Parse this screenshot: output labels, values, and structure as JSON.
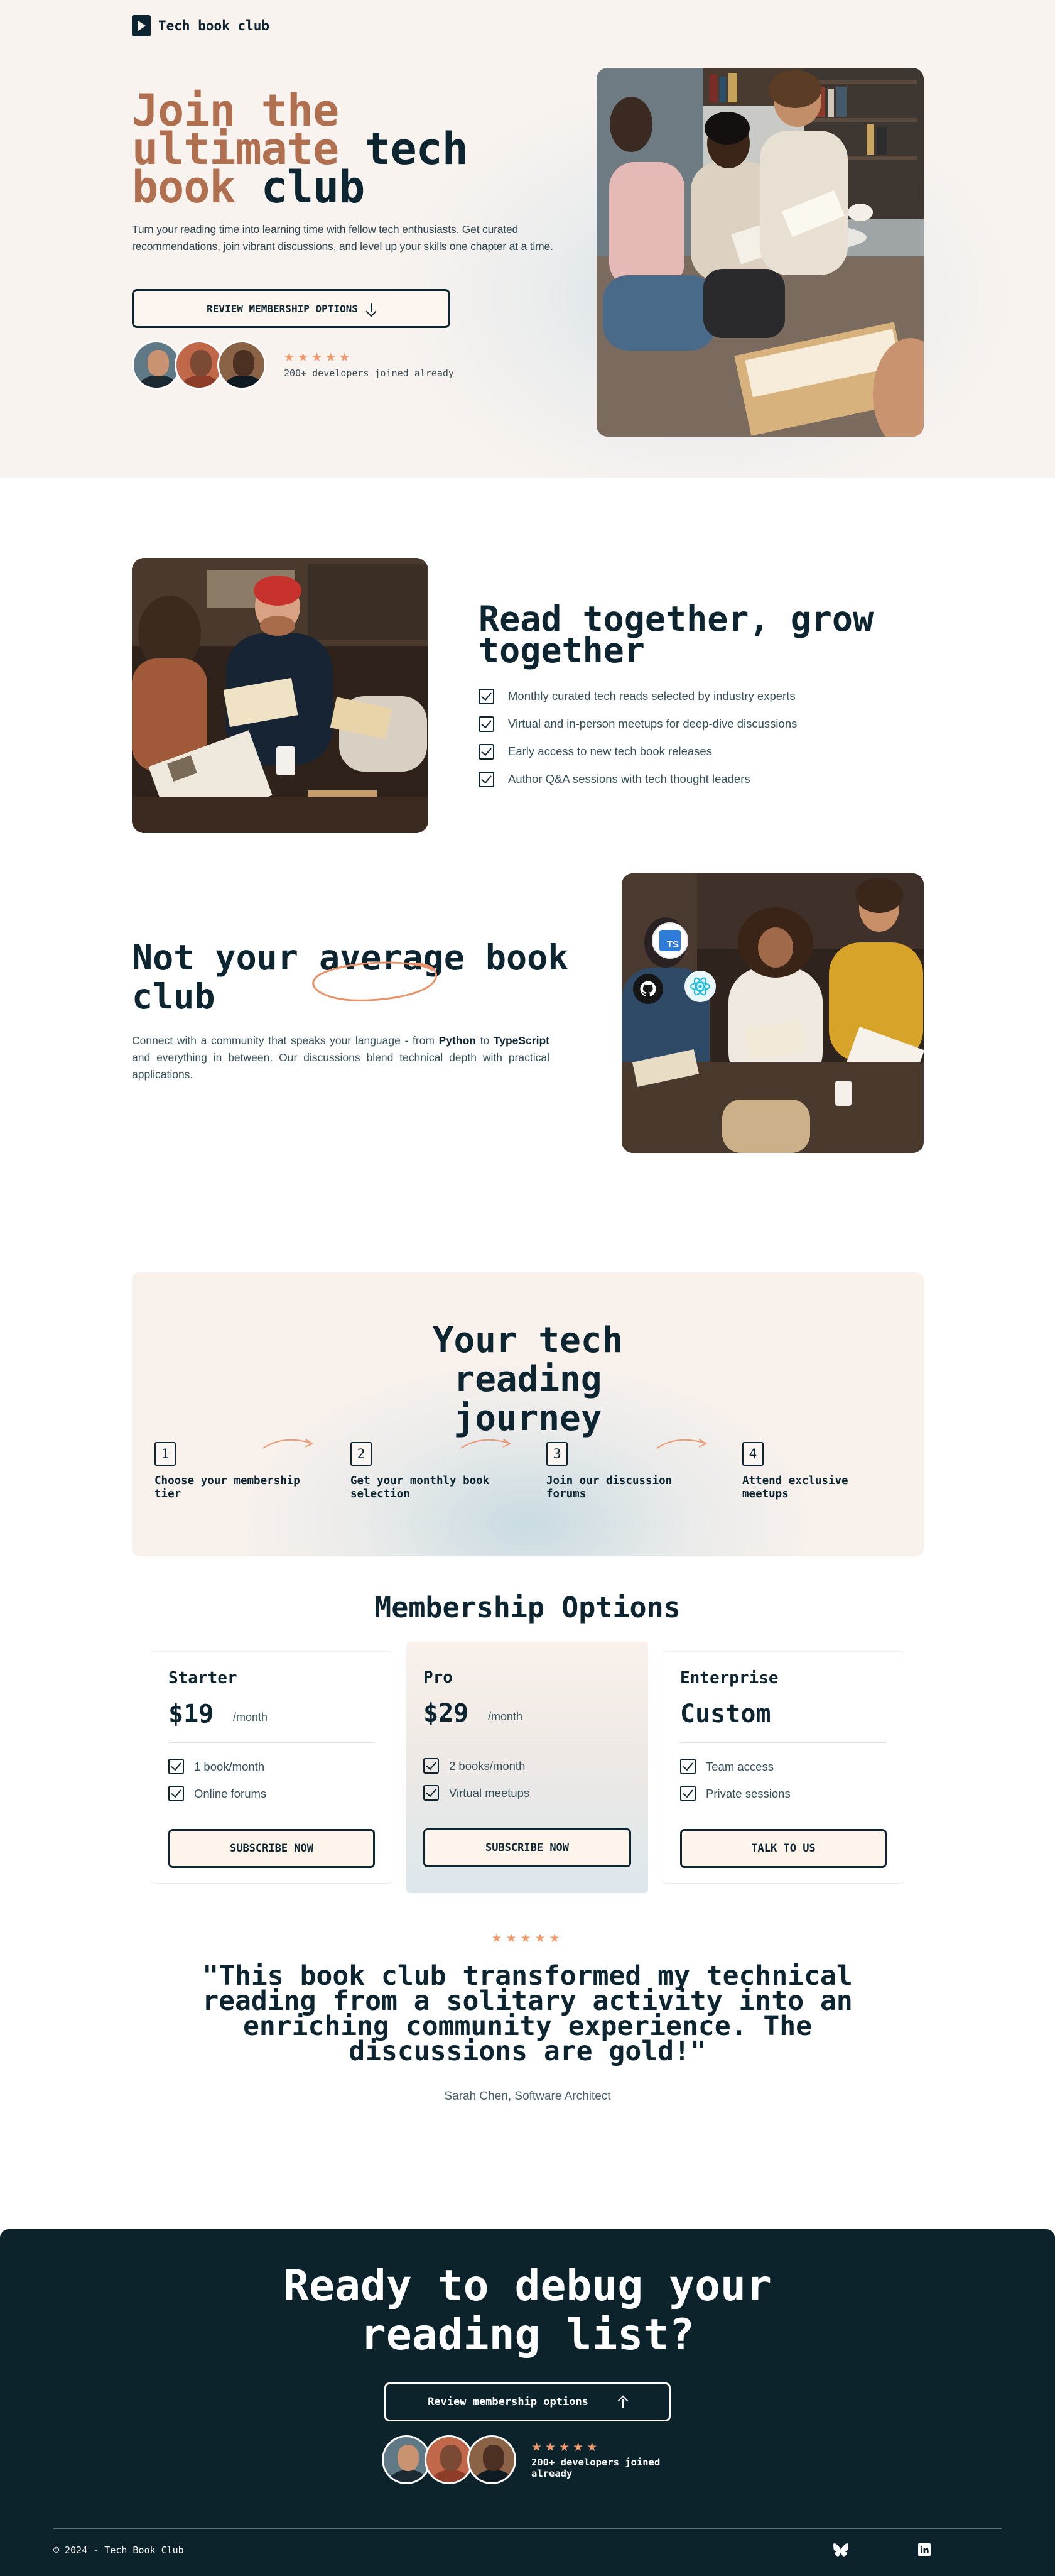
{
  "brand": {
    "name": "Tech book club"
  },
  "hero": {
    "title_line1": "Join the",
    "title_line2_accent": "ultimate",
    "title_line2_rest": " tech",
    "title_line3_accent": "book",
    "title_line3_rest": " club",
    "description": "Turn your reading time into learning time with fellow tech enthusiasts. Get curated recommendations, join vibrant discussions, and level up your skills one chapter at a time.",
    "cta_label": "REVIEW MEMBERSHIP OPTIONS",
    "stars": "★★★★★",
    "joined_text": "200+ developers joined already"
  },
  "read_together": {
    "title": "Read together, grow together",
    "items": [
      "Monthly curated tech reads selected by industry experts",
      "Virtual and in-person meetups for deep-dive discussions",
      "Early access to new tech book releases",
      "Author Q&A sessions with tech thought leaders"
    ]
  },
  "average": {
    "title_line1": "Not your average book",
    "title_line2": "club",
    "desc_before": "Connect with a community that speaks your language - from ",
    "desc_python": "Python",
    "desc_mid": " to ",
    "desc_typescript": "TypeScript",
    "desc_after": " and everything in between. Our discussions blend technical depth with practical applications.",
    "badge_ts": "TS"
  },
  "journey": {
    "title": "Your tech reading journey",
    "steps": [
      {
        "num": "1",
        "label": "Choose your membership tier"
      },
      {
        "num": "2",
        "label": "Get your monthly book selection"
      },
      {
        "num": "3",
        "label": "Join our discussion forums"
      },
      {
        "num": "4",
        "label": "Attend exclusive meetups"
      }
    ]
  },
  "membership": {
    "title": "Membership Options",
    "plans": [
      {
        "name": "Starter",
        "price": "$19",
        "period": "/month",
        "features": [
          "1 book/month",
          "Online forums"
        ],
        "button": "SUBSCRIBE NOW"
      },
      {
        "name": "Pro",
        "price": "$29",
        "period": "/month",
        "features": [
          "2 books/month",
          "Virtual meetups"
        ],
        "button": "SUBSCRIBE NOW"
      },
      {
        "name": "Enterprise",
        "price": "Custom",
        "period": "",
        "features": [
          "Team access",
          "Private sessions"
        ],
        "button": "TALK TO US"
      }
    ]
  },
  "testimonial": {
    "stars": "★★★★★",
    "quote": "\"This book club transformed my technical reading from a solitary activity into an enriching community experience. The discussions are gold!\"",
    "author": "Sarah Chen, Software Architect"
  },
  "cta": {
    "title": "Ready to debug your reading list?",
    "button": "Review membership options",
    "stars": "★★★★★",
    "joined_text": "200+ developers joined already"
  },
  "footer": {
    "copyright": "© 2024 - Tech Book Club",
    "icons": [
      "bluesky-icon",
      "linkedin-icon"
    ]
  },
  "colors": {
    "dark": "#0d2530",
    "accent": "#b0704f",
    "star": "#f0986b",
    "cream": "#f9f3ef"
  }
}
